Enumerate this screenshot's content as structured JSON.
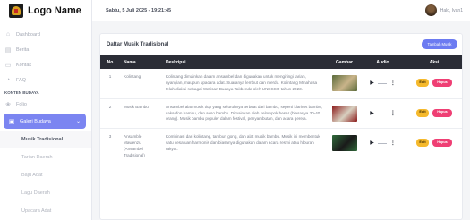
{
  "brand": {
    "name": "Logo Name"
  },
  "sidebar": {
    "items": [
      {
        "label": "Dashboard",
        "icon": "home-icon"
      },
      {
        "label": "Berita",
        "icon": "news-icon"
      },
      {
        "label": "Kontak",
        "icon": "chat-icon"
      },
      {
        "label": "FAQ",
        "icon": "help-icon"
      }
    ],
    "section_heading": "KONTEN BUDAYA",
    "folio": {
      "label": "Folio",
      "icon": "folio-icon"
    },
    "active": {
      "label": "Galeri Budaya",
      "icon": "gallery-icon"
    },
    "sub_items": [
      {
        "label": "Musik Tradisional"
      },
      {
        "label": "Tarian Daerah"
      },
      {
        "label": "Baju Adat"
      },
      {
        "label": "Lagu Daerah"
      },
      {
        "label": "Upacara Adat"
      }
    ]
  },
  "header": {
    "datetime": "Sabtu, 5 Juli 2025 - 19:21:45",
    "user_label": "Halo, Ivan1"
  },
  "card": {
    "title": "Daftar Musik Tradisional",
    "add_button": "Tambah Musik"
  },
  "table": {
    "columns": [
      "No",
      "Nama",
      "Deskripsi",
      "Gambar",
      "Audio",
      "Aksi"
    ],
    "edit_label": "Edit",
    "delete_label": "Hapus",
    "rows": [
      {
        "no": "1",
        "nama": "Kolintang",
        "deskripsi": "Kolintang dimainkan dalam ansambel dan digunakan untuk mengiringi tarian, nyanyian, maupun upacara adat. Suaranya lembut dan merdu. Kolintang Minahasa telah diakui sebagai Warisan Budaya Takbenda oleh UNESCO tahun 2023.",
        "image_colors": [
          "#5a6a3a",
          "#c9b48a"
        ]
      },
      {
        "no": "2",
        "nama": "Musik Bambu",
        "deskripsi": "Ansambel alat musik tiup yang seluruhnya terbuat dari bambu, seperti klarinet bambu, saksofon bambu, dan seso bambu. Dimainkan oleh kelompok besar (biasanya 30-40 orang). Musik bambu populer dalam festival, penyambutan, dan acara gereja.",
        "image_colors": [
          "#8b1a1a",
          "#d8d0c0"
        ]
      },
      {
        "no": "3",
        "nama": "Ansamble Mawenzu (Ansambel Tradisional)",
        "deskripsi": "Kombinasi dari kolintang, tambur, gong, dan alat musik bambu. Musik ini membentuk satu kesatuan harmonis dan biasanya digunakan dalam acara resmi atau hiburan rakyat.",
        "image_colors": [
          "#2f6a3a",
          "#1a1a1a"
        ]
      }
    ]
  }
}
